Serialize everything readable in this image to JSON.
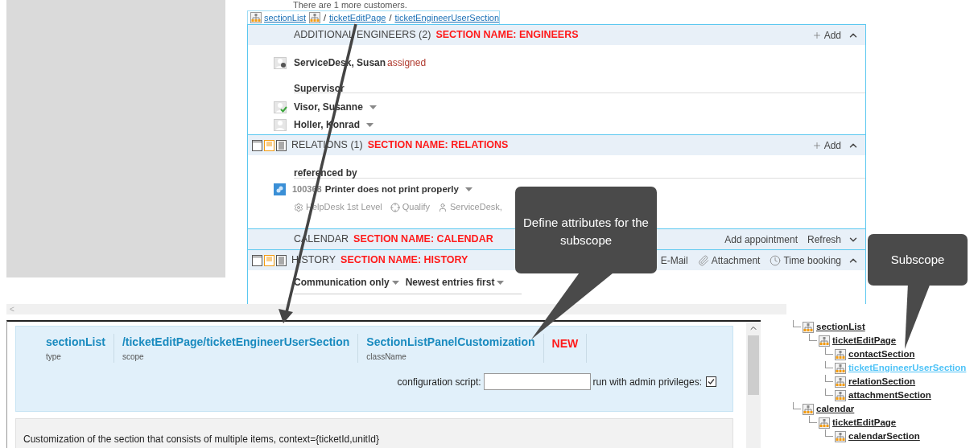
{
  "notice": "There are 1 more customers.",
  "breadcrumb": [
    {
      "kind": "root",
      "label": "sectionList"
    },
    {
      "kind": "icon"
    },
    {
      "kind": "link",
      "separator": "/",
      "label": "ticketEditPage"
    },
    {
      "kind": "link",
      "separator": "/",
      "label": "ticketEngineerUserSection"
    }
  ],
  "sections": [
    {
      "title": "ADDITIONAL ENGINEERS (2)",
      "tag": "SECTION NAME: ENGINEERS",
      "view_icons": false,
      "expanded": true,
      "actions": [
        {
          "kind": "add",
          "label": "Add"
        }
      ],
      "body": {
        "kind": "people",
        "rows": [
          {
            "kind": "group",
            "name": "ServiceDesk, Susan",
            "status": "assigned"
          },
          {
            "kind": "heading",
            "label": "Supervisor"
          },
          {
            "kind": "person",
            "name": "Visor, Susanne",
            "approved": true
          },
          {
            "kind": "person",
            "name": "Holler, Konrad",
            "approved": false
          }
        ]
      }
    },
    {
      "title": "RELATIONS (1)",
      "tag": "SECTION NAME: RELATIONS",
      "view_icons": true,
      "expanded": true,
      "actions": [
        {
          "kind": "add",
          "label": "Add"
        }
      ],
      "body": {
        "kind": "relations",
        "heading": "referenced by",
        "ticket": {
          "number": "100368",
          "title": "Printer does not print properly",
          "meta": [
            {
              "kind": "gear",
              "label": "HelpDesk 1st Level"
            },
            {
              "kind": "target",
              "label": "Qualify"
            },
            {
              "kind": "user",
              "label": "ServiceDesk,"
            }
          ]
        }
      }
    },
    {
      "title": "CALENDAR",
      "tag": "SECTION NAME: CALENDAR",
      "view_icons": false,
      "expanded": false,
      "actions": [
        {
          "kind": "text",
          "label": "Add appointment"
        },
        {
          "kind": "text",
          "label": "Refresh"
        }
      ]
    },
    {
      "title": "HISTORY",
      "tag": "SECTION NAME: HISTORY",
      "view_icons": true,
      "expanded": true,
      "actions": [
        {
          "kind": "text",
          "label": "E-Mail"
        },
        {
          "kind": "paperclip",
          "label": "Attachment"
        },
        {
          "kind": "clock",
          "label": "Time booking"
        }
      ],
      "body": {
        "kind": "filters",
        "items": [
          "Communication only",
          "Newest entries first"
        ]
      }
    }
  ],
  "scroll_left": "<",
  "customization": {
    "columns": [
      {
        "value": "sectionList",
        "label": "type"
      },
      {
        "value": "/ticketEditPage/ticketEngineerUserSection",
        "label": "scope"
      },
      {
        "value": "SectionListPanelCustomization",
        "label": "className"
      }
    ],
    "badge": "NEW",
    "script_label": "configuration script:",
    "admin_label": "run with admin privileges:",
    "admin_checked": true,
    "description": "Customization of the section that consists of multiple items, context={ticketId,unitId}"
  },
  "tree": [
    {
      "label": "sectionList",
      "selected": false,
      "children": [
        {
          "label": "ticketEditPage",
          "selected": false,
          "children": [
            {
              "label": "contactSection",
              "selected": false
            },
            {
              "label": "ticketEngineerUserSection",
              "selected": true
            },
            {
              "label": "relationSection",
              "selected": false
            },
            {
              "label": "attachmentSection",
              "selected": false
            }
          ]
        }
      ]
    },
    {
      "label": "calendar",
      "selected": false,
      "children": [
        {
          "label": "ticketEditPage",
          "selected": false,
          "children": [
            {
              "label": "calendarSection",
              "selected": false
            }
          ]
        }
      ]
    }
  ],
  "callouts": [
    {
      "text": "Define attributes for the subscope"
    },
    {
      "text": "Subscope"
    }
  ]
}
